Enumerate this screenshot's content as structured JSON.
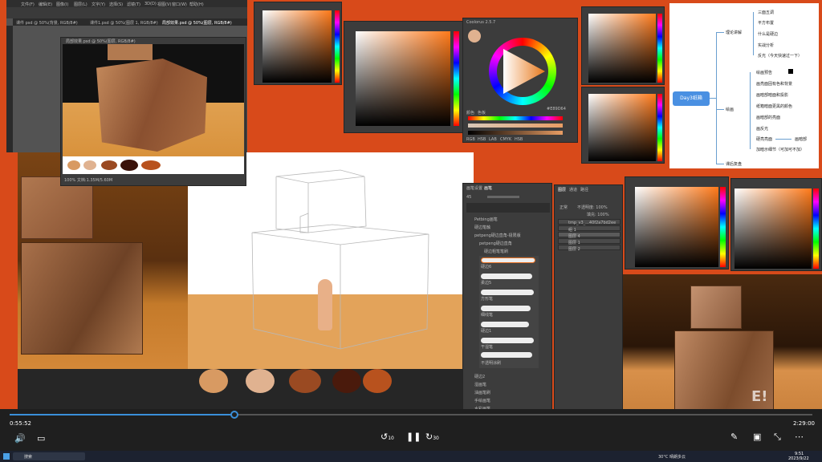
{
  "ps_menu": [
    "文件(F)",
    "编辑(E)",
    "图像(I)",
    "图层(L)",
    "文字(Y)",
    "选择(S)",
    "滤镜(T)",
    "3D(D)",
    "视图(V)",
    "窗口(W)",
    "帮助(H)"
  ],
  "ps_tabs": [
    "课件 psd @ 50%(背景, RGB/8#)",
    "课件1.psd @ 50%(图层 1, RGB/8#)",
    "局部效果.psd @ 50%(图层, RGB/8#)"
  ],
  "ref_window_title": "局部效果.psd @ 50%(图层, RGB/8#)",
  "ref_status": "100%  文档:1.35M/5.60M",
  "color_wheel_title": "Coolorus 2.5.7",
  "color_wheel_tabs": [
    "颜色",
    "色板"
  ],
  "wheel_labels": [
    "RGB",
    "HSB",
    "LAB",
    "CMYK",
    "HSB"
  ],
  "hex_value": "#E89D64",
  "brush_panel_tabs": [
    "画笔设置",
    "画笔"
  ],
  "brush_folders": [
    "Petbing画笔",
    "硬边笔触",
    "petpeng硬边直角-极限版",
    "petpeng硬边直角",
    "硬边粗笔笔刷",
    "硬边6",
    "柔边5",
    "方形笔",
    "细线笔",
    "硬边1",
    "干湿笔",
    "不透明涂刷",
    "硬边2",
    "湿画笔",
    "油画笔刷",
    "手绘画笔",
    "水彩画笔",
    "造型笔刷",
    "素描笔刷",
    "炭笔"
  ],
  "brush_size": "45",
  "layers_tabs": [
    "图层",
    "通道",
    "路径"
  ],
  "layers_blend": "正常",
  "layers_opacity": "不透明度: 100%",
  "layers_fill": "填充: 100%",
  "layers": [
    "tmp_v3_...40f2a7bd2ee",
    "组 1",
    "图层 4",
    "图层 1",
    "图层 2"
  ],
  "mindmap": {
    "center": "Day3纸箱",
    "b1": "理论讲解",
    "b1_items": [
      "三面五调",
      "平方布置",
      "什么是硬边",
      "实战分析",
      "反光（今天快速过一下）"
    ],
    "b2": "绘画",
    "b2_items": [
      "绘画预告",
      "画亮面固有色和背景",
      "画暗部暗面和投影",
      "纸箱暗面更黑的颜色",
      "画暗部的亮面",
      "画反光",
      "硬亮亮面",
      "加暗示细节（可加可不加）"
    ],
    "b2_extra": "画暗部",
    "b3": "课后复盘"
  },
  "player": {
    "time_current": "0:55:52",
    "time_total": "2:29:00",
    "progress": 0.28,
    "rewind_label": "10",
    "forward_label": "30",
    "logo": "E!"
  },
  "taskbar": {
    "search": "搜索",
    "weather": "30°C 晴朗多云",
    "clock_time": "9:51",
    "clock_date": "2023/9/22"
  },
  "colors": {
    "accent": "#3a8fd9",
    "swatches": [
      "#d89a62",
      "#e0b290",
      "#9a4a22",
      "#4a1a0c",
      "#b8521e"
    ]
  }
}
